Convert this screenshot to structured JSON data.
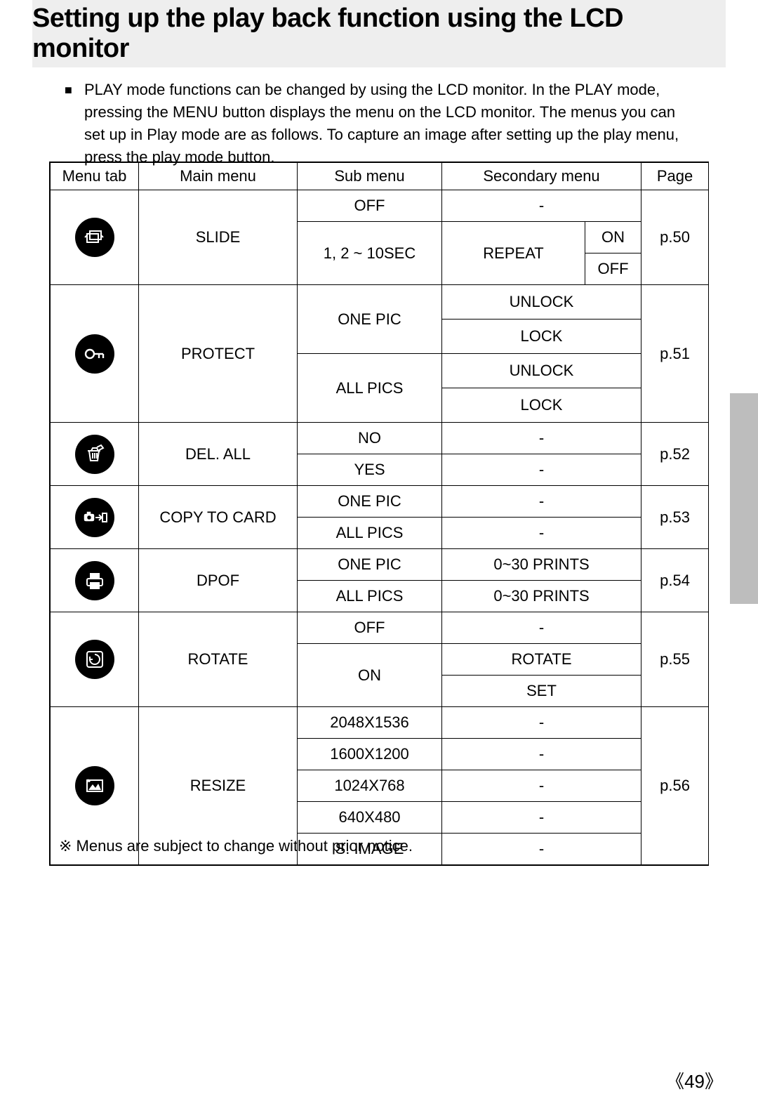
{
  "header": {
    "title": "Setting up the play back function using the LCD monitor"
  },
  "intro": {
    "bullet": "■",
    "text": "PLAY mode functions can be changed by using the LCD monitor. In the PLAY mode, pressing the MENU button displays the menu on the LCD monitor. The menus you can set up in Play mode are as follows. To capture an image after setting up the play menu, press the play mode button."
  },
  "table": {
    "headers": [
      "Menu tab",
      "Main menu",
      "Sub menu",
      "Secondary menu",
      "Page"
    ],
    "rows": {
      "slide": {
        "main": "SLIDE",
        "sub_off": "OFF",
        "sec_off": "-",
        "sub_interval": "1, 2 ~ 10SEC",
        "sec_repeat": "REPEAT",
        "sec_on": "ON",
        "sec_off2": "OFF",
        "page": "p.50"
      },
      "protect": {
        "main": "PROTECT",
        "sub_one": "ONE PIC",
        "sub_all": "ALL PICS",
        "sec_unlock": "UNLOCK",
        "sec_lock": "LOCK",
        "page": "p.51"
      },
      "delall": {
        "main": "DEL. ALL",
        "sub_no": "NO",
        "sub_yes": "YES",
        "sec": "-",
        "page": "p.52"
      },
      "copy": {
        "main": "COPY TO CARD",
        "sub_one": "ONE PIC",
        "sub_all": "ALL PICS",
        "sec": "-",
        "page": "p.53"
      },
      "dpof": {
        "main": "DPOF",
        "sub_one": "ONE PIC",
        "sub_all": "ALL PICS",
        "sec": "0~30 PRINTS",
        "page": "p.54"
      },
      "rotate": {
        "main": "ROTATE",
        "sub_off": "OFF",
        "sec_off": "-",
        "sub_on": "ON",
        "sec_rotate": "ROTATE",
        "sec_set": "SET",
        "page": "p.55"
      },
      "resize": {
        "main": "RESIZE",
        "subs": [
          "2048X1536",
          "1600X1200",
          "1024X768",
          "640X480",
          "S. IMAGE"
        ],
        "sec": "-",
        "page": "p.56"
      }
    }
  },
  "footnote": "※ Menus are subject to change without prior notice.",
  "page_number": "49"
}
